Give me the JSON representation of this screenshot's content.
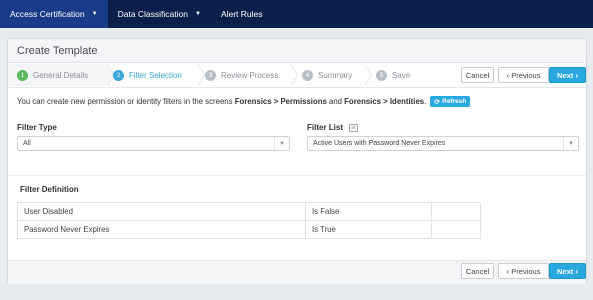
{
  "nav": {
    "items": [
      {
        "label": "Access Certification",
        "active": true
      },
      {
        "label": "Data Classification",
        "active": false
      },
      {
        "label": "Alert Rules",
        "active": false
      }
    ]
  },
  "panel": {
    "title": "Create Template"
  },
  "steps": [
    {
      "num": "1",
      "label": "General Details",
      "state": "done"
    },
    {
      "num": "2",
      "label": "Filter Selection",
      "state": "current"
    },
    {
      "num": "3",
      "label": "Review Process",
      "state": "pending"
    },
    {
      "num": "4",
      "label": "Summary",
      "state": "pending"
    },
    {
      "num": "5",
      "label": "Save",
      "state": "pending"
    }
  ],
  "actions": {
    "cancel": "Cancel",
    "previous": "Previous",
    "next": "Next"
  },
  "info": {
    "text_before": "You can create new permission or identity filters in the screens",
    "link1": "Forensics > Permissions",
    "and": "and",
    "link2": "Forensics > Identities",
    "after": ".",
    "refresh": "Refresh"
  },
  "filter_type": {
    "label": "Filter Type",
    "value": "All"
  },
  "filter_list": {
    "label": "Filter List",
    "value": "Active Users with Password Never Expires"
  },
  "filter_definition": {
    "title": "Filter Definition",
    "rows": [
      {
        "attribute": "User Disabled",
        "condition": "Is False",
        "value": ""
      },
      {
        "attribute": "Password Never Expires",
        "condition": "Is True",
        "value": ""
      }
    ]
  },
  "colors": {
    "nav_bg": "#0c1f4a",
    "nav_active": "#1a3a8a",
    "accent": "#29a8e0",
    "step_done": "#5cb85c",
    "step_current": "#39a7da"
  }
}
